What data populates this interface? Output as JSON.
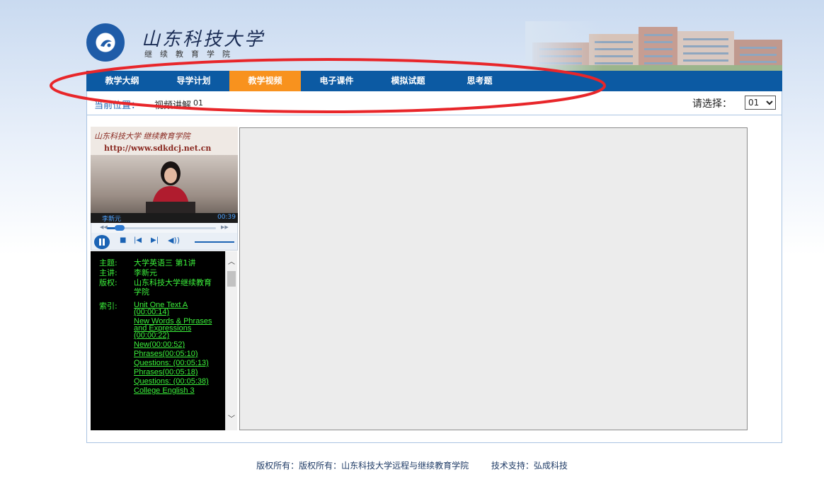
{
  "header": {
    "school_name": "山东科技大学",
    "school_sub": "继续教育学院"
  },
  "nav": {
    "items": [
      {
        "label": "教学大纲"
      },
      {
        "label": "导学计划"
      },
      {
        "label": "教学视频",
        "active": true
      },
      {
        "label": "电子课件"
      },
      {
        "label": "模拟试题"
      },
      {
        "label": "思考题"
      }
    ]
  },
  "location": {
    "label": "当前位置：",
    "path": "视频讲解",
    "episode": "01",
    "select_label": "请选择：",
    "selected": "01"
  },
  "player": {
    "watermark_title": "山东科技大学 继续教育学院",
    "watermark_url": "http://www.sdkdcj.net.cn",
    "speaker": "李新元",
    "time": "00:39",
    "progress": 0.12
  },
  "info": {
    "topic_key": "主题:",
    "topic_val": "大学英语三 第1讲",
    "lecturer_key": "主讲:",
    "lecturer_val": "李新元",
    "copyright_key": "版权:",
    "copyright_val": "山东科技大学继续教育学院",
    "index_key": "索引:",
    "index_items": [
      "Unit One Text A (00:00:14)",
      "New Words & Phrases and Expressions (00:00:22)",
      "New(00:00:52)",
      "Phrases(00:05:10)",
      "Questions: (00:05:13)",
      "Phrases(00:05:18)",
      "Questions: (00:05:38)",
      "College English 3"
    ]
  },
  "footer": {
    "copyright": "版权所有：版权所有：山东科技大学远程与继续教育学院",
    "support": "技术支持：弘成科技"
  },
  "colors": {
    "nav_bg": "#0c5aa3",
    "nav_active": "#f8921e",
    "info_text": "#3cf23c",
    "annotation": "#e8262a"
  },
  "icons": [
    "school-emblem-icon",
    "pause-icon",
    "stop-icon",
    "prev-icon",
    "next-icon",
    "volume-icon",
    "rewind-icon",
    "fast-forward-icon",
    "chevron-down-icon",
    "scroll-up-icon",
    "scroll-down-icon"
  ]
}
